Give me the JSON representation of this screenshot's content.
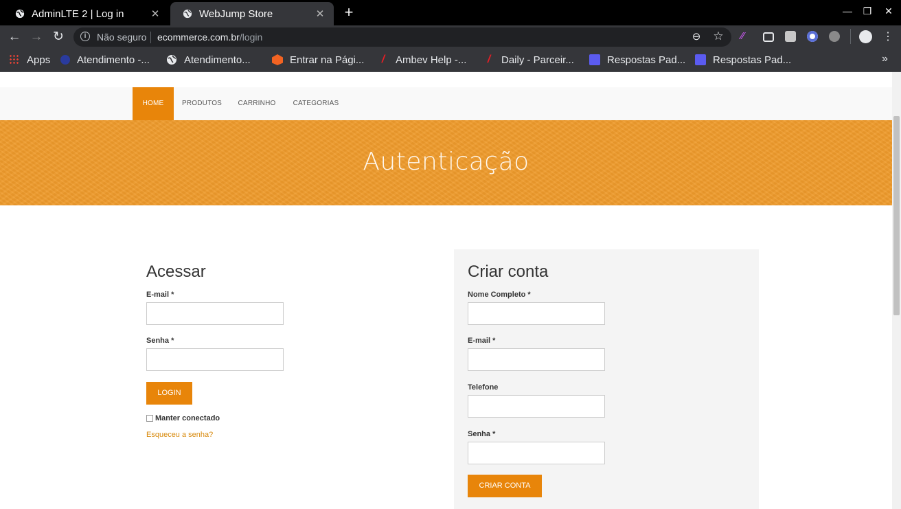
{
  "browser": {
    "tabs": [
      {
        "label": "AdminLTE 2 | Log in"
      },
      {
        "label": "WebJump Store"
      }
    ],
    "new_tab_label": "+",
    "address": {
      "security_text": "Não seguro",
      "url_host": "ecommerce.com.br",
      "url_path": "/login"
    },
    "bookmarks": [
      {
        "label": "Apps",
        "icon": "apps-grid-icon"
      },
      {
        "label": "Atendimento -...",
        "icon": "site-icon"
      },
      {
        "label": "Atendimento...",
        "icon": "globe-icon"
      },
      {
        "label": "Entrar na Pági...",
        "icon": "magento-icon"
      },
      {
        "label": "Ambev Help -...",
        "icon": "slash-icon"
      },
      {
        "label": "Daily - Parceir...",
        "icon": "slash-icon"
      },
      {
        "label": "Respostas Pad...",
        "icon": "doc-icon"
      },
      {
        "label": "Respostas Pad...",
        "icon": "doc-icon"
      }
    ],
    "colors": {
      "accent": "#e8850a",
      "banner": "#ee9a2b"
    }
  },
  "site": {
    "nav": [
      {
        "label": "HOME"
      },
      {
        "label": "PRODUTOS"
      },
      {
        "label": "CARRINHO"
      },
      {
        "label": "CATEGORIAS"
      }
    ],
    "banner_title": "Autenticação"
  },
  "login": {
    "title": "Acessar",
    "email_label": "E-mail *",
    "password_label": "Senha *",
    "button": "LOGIN",
    "remember_label": "Manter conectado",
    "forgot_link": "Esqueceu a senha?"
  },
  "register": {
    "title": "Criar conta",
    "name_label": "Nome Completo *",
    "email_label": "E-mail *",
    "phone_label": "Telefone",
    "password_label": "Senha *",
    "button": "CRIAR CONTA"
  }
}
